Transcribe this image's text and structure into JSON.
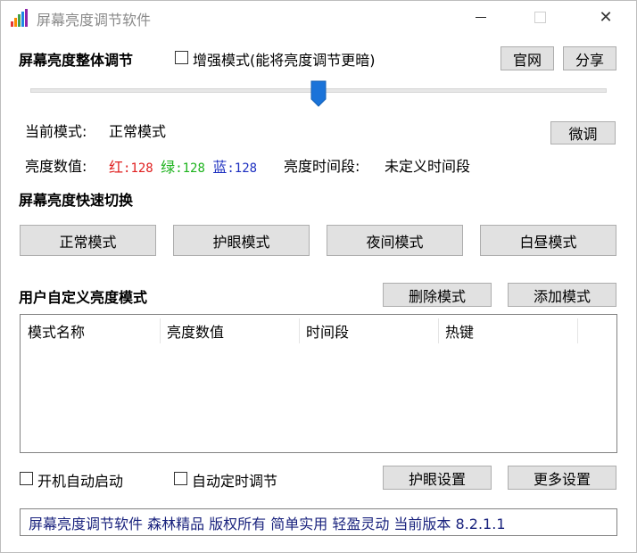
{
  "window": {
    "title": "屏幕亮度调节软件",
    "close_glyph": "✕"
  },
  "brightness": {
    "section_title": "屏幕亮度整体调节",
    "enhanced_mode_label": "增强模式(能将亮度调节更暗)",
    "enhanced_mode_checked": false,
    "official_site_button": "官网",
    "share_button": "分享",
    "slider_value": 0.5
  },
  "status": {
    "current_mode_label": "当前模式:",
    "current_mode_value": "正常模式",
    "fine_tune_button": "微调",
    "value_label": "亮度数值:",
    "red_label": "红",
    "red_value": ":128",
    "green_label": "绿",
    "green_value": ":128",
    "blue_label": "蓝",
    "blue_value": ":128",
    "time_period_label": "亮度时间段:",
    "time_period_value": "未定义时间段"
  },
  "quick_switch": {
    "section_title": "屏幕亮度快速切换",
    "buttons": [
      "正常模式",
      "护眼模式",
      "夜间模式",
      "白昼模式"
    ]
  },
  "custom_modes": {
    "section_title": "用户自定义亮度模式",
    "delete_button": "删除模式",
    "add_button": "添加模式",
    "columns": [
      "模式名称",
      "亮度数值",
      "时间段",
      "热键"
    ],
    "rows": []
  },
  "options": {
    "autostart_label": "开机自动启动",
    "autostart_checked": false,
    "auto_timed_label": "自动定时调节",
    "auto_timed_checked": false,
    "eye_settings_button": "护眼设置",
    "more_settings_button": "更多设置"
  },
  "footer": {
    "text": "屏幕亮度调节软件 森林精品 版权所有 简单实用 轻盈灵动 当前版本 8.2.1.1"
  },
  "colors": {
    "red": "#e02020",
    "green": "#1db31d",
    "blue": "#1c2fc0",
    "thumb": "#1a73d9",
    "footer_text": "#1a237e"
  }
}
